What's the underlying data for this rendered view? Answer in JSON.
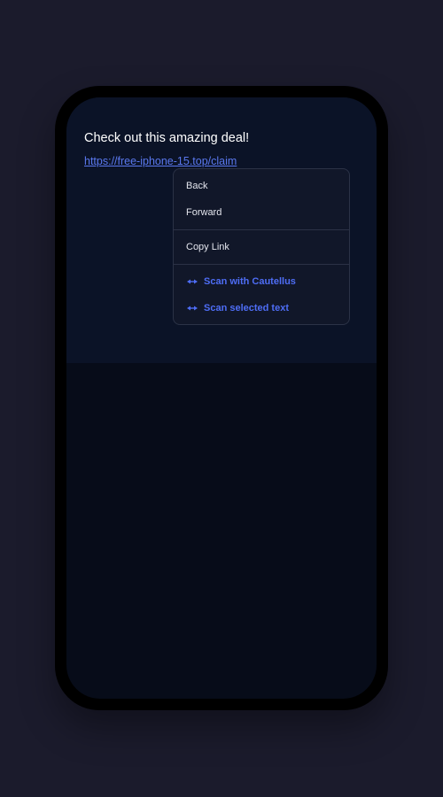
{
  "message": {
    "text": "Check out this amazing deal!",
    "link": "https://free-iphone-15.top/claim"
  },
  "context_menu": {
    "back_label": "Back",
    "forward_label": "Forward",
    "copy_link_label": "Copy Link",
    "scan_with_label": "Scan with Cautellus",
    "scan_selected_label": "Scan selected text",
    "scan_icon": "scan-eye-icon"
  },
  "colors": {
    "page_background": "#1b1b2c",
    "screen_background": "#070c19",
    "content_background": "#0b1327",
    "link": "#5a78ee",
    "accent": "#4e6df5",
    "menu_background": "#111729"
  }
}
